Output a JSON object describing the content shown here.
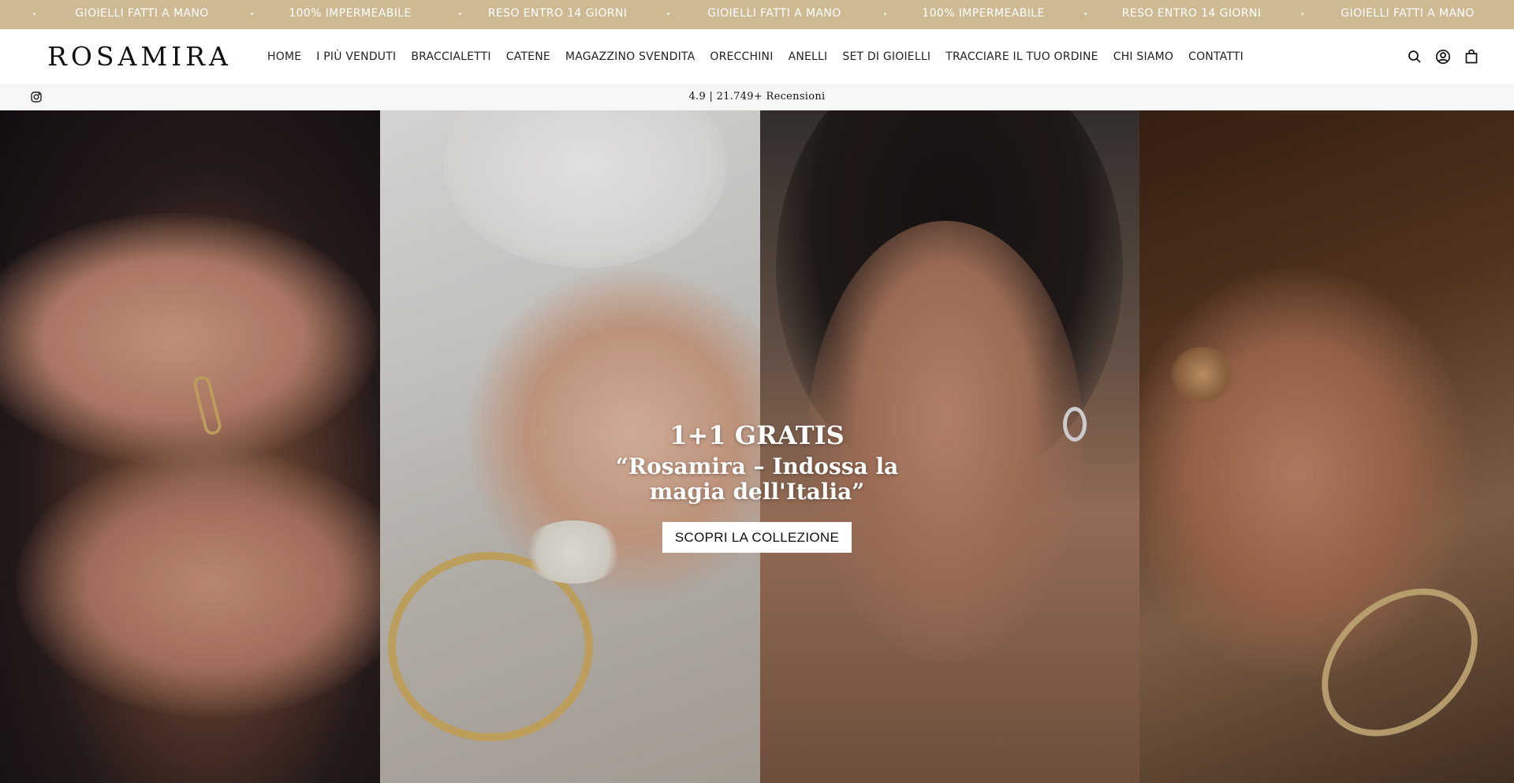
{
  "announcement": {
    "items": [
      "Gioielli fatti a mano",
      "100% impermeabile",
      "Reso entro 14 giorni",
      "Gioielli fatti a mano",
      "100% impermeabile",
      "Reso entro 14 giorni",
      "Gioielli fatti a mano"
    ],
    "background": "#cdb992"
  },
  "header": {
    "logo": "ROSAMIRA",
    "nav": [
      "Home",
      "I più venduti",
      "Braccialetti",
      "Catene",
      "Magazzino svendita",
      "Orecchini",
      "Anelli",
      "Set di gioielli",
      "Tracciare il tuo ordine",
      "Chi siamo",
      "Contatti"
    ],
    "icons": [
      "search-icon",
      "account-icon",
      "cart-icon"
    ]
  },
  "review_bar": {
    "social_icon": "instagram-icon",
    "text": "4.9 | 21.749+ Recensioni"
  },
  "hero": {
    "title": "1+1 GRATIS",
    "subtitle": "“Rosamira – Indossa la magia dell'Italia”",
    "button_label": "SCOPRI LA COLLEZIONE"
  }
}
